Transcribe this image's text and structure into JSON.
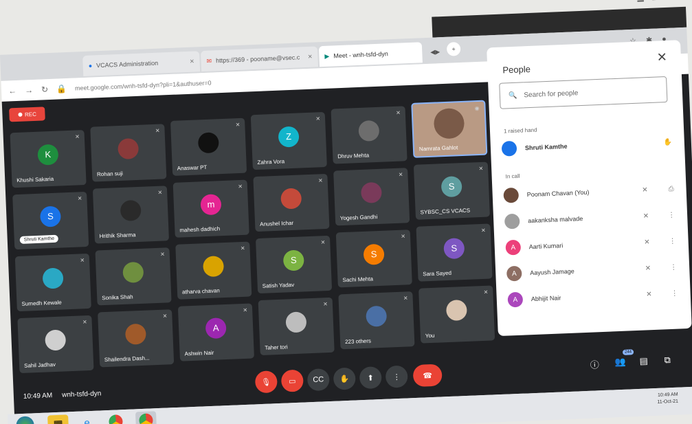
{
  "browser": {
    "tabs": [
      {
        "label": "VCACS Administration",
        "active": false
      },
      {
        "label": "https://369 - pooname@vsec.c",
        "active": false
      },
      {
        "label": "Meet - wnh-tsfd-dyn",
        "active": true
      }
    ],
    "url": "meet.google.com/wnh-tsfd-dyn?pli=1&authuser=0"
  },
  "meet": {
    "rec_label": "REC",
    "time": "10:49 AM",
    "meeting_code": "wnh-tsfd-dyn",
    "participants_badge": "244",
    "raised_hand_chip": "Shruti Kamthe",
    "tiles": [
      {
        "name": "Khushi Sakaria",
        "initial": "K",
        "color": "#1e8e3e"
      },
      {
        "name": "Rohan suji",
        "initial": "",
        "color": "#8a3a3a"
      },
      {
        "name": "Anaswar PT",
        "initial": "",
        "color": "#111111"
      },
      {
        "name": "Zahra Vora",
        "initial": "Z",
        "color": "#12b5cb"
      },
      {
        "name": "Dhruv Mehta",
        "initial": "",
        "color": "#6d6d6d"
      },
      {
        "name": "Namrata Gahlot",
        "initial": "",
        "color": "#b99a84"
      },
      {
        "name": "",
        "initial": "S",
        "color": "#1a73e8"
      },
      {
        "name": "Hrithik Sharma",
        "initial": "",
        "color": "#2a2a2a"
      },
      {
        "name": "mahesh dadhich",
        "initial": "m",
        "color": "#e52592"
      },
      {
        "name": "Anushel Ichar",
        "initial": "",
        "color": "#c44a3a"
      },
      {
        "name": "Yogesh Gandhi",
        "initial": "",
        "color": "#7a3a5a"
      },
      {
        "name": "SYBSC_CS VCACS",
        "initial": "S",
        "color": "#5f9ea0"
      },
      {
        "name": "Sumedh Kewale",
        "initial": "",
        "color": "#2aa8c4"
      },
      {
        "name": "Sonika Shah",
        "initial": "",
        "color": "#6f8f3f"
      },
      {
        "name": "atharva chavan",
        "initial": "",
        "color": "#d9a300"
      },
      {
        "name": "Satish Yadav",
        "initial": "S",
        "color": "#7cb342"
      },
      {
        "name": "Sachi Mehta",
        "initial": "S",
        "color": "#f57c00"
      },
      {
        "name": "Sara Sayed",
        "initial": "S",
        "color": "#7e57c2"
      },
      {
        "name": "Sahil Jadhav",
        "initial": "",
        "color": "#cfcfcf"
      },
      {
        "name": "Shailendra Dash...",
        "initial": "",
        "color": "#a05a2a"
      },
      {
        "name": "Ashwin Nair",
        "initial": "A",
        "color": "#9c27b0"
      },
      {
        "name": "Taher tori",
        "initial": "",
        "color": "#bdbdbd"
      },
      {
        "name": "223 others",
        "initial": "",
        "color": "#4a6fa5"
      },
      {
        "name": "You",
        "initial": "",
        "color": "#d9c4b0"
      }
    ]
  },
  "people": {
    "title": "People",
    "search_placeholder": "Search for people",
    "raised_hand_header": "1 raised hand",
    "raised_hand_name": "Shruti Kamthe",
    "in_call_header": "In call",
    "in_call": [
      {
        "name": "Poonam Chavan (You)",
        "initial": "",
        "color": "#6a4a3a"
      },
      {
        "name": "aakanksha malvade",
        "initial": "",
        "color": "#9e9e9e"
      },
      {
        "name": "Aarti Kumari",
        "initial": "A",
        "color": "#ec407a"
      },
      {
        "name": "Aayush Jamage",
        "initial": "A",
        "color": "#8d6e63"
      },
      {
        "name": "Abhijit Nair",
        "initial": "A",
        "color": "#ab47bc"
      }
    ]
  },
  "taskbar": {
    "clock_time": "10:49 AM",
    "clock_date": "11-Oct-21"
  },
  "colors": {
    "accent": "#8ab4f8",
    "danger": "#ea4335",
    "meet_bg": "#202124"
  }
}
